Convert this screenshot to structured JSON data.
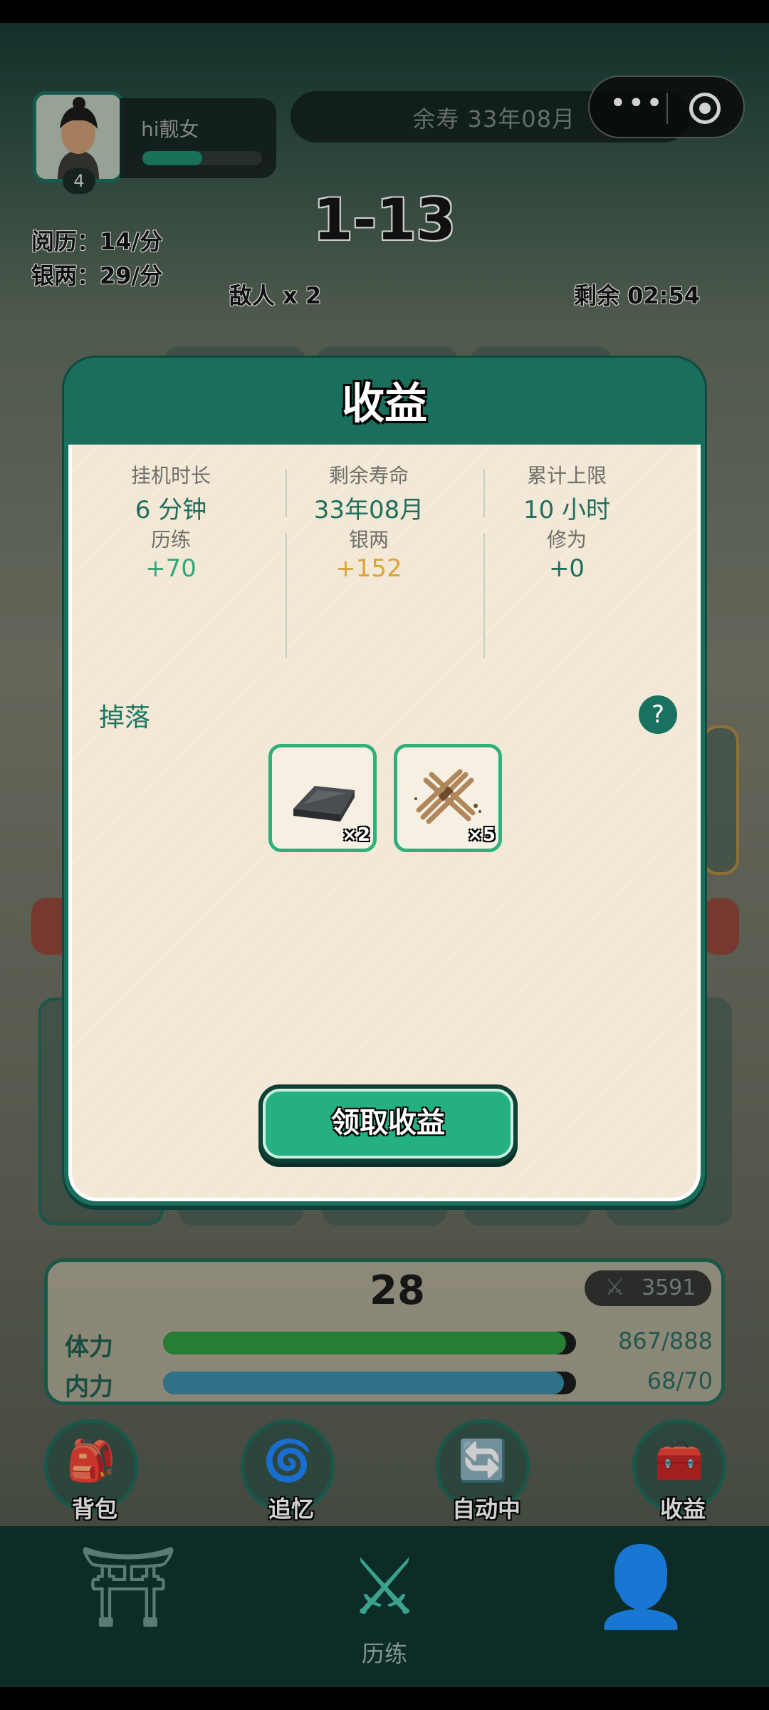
{
  "header": {
    "player_name": "hi靓女",
    "level": "4",
    "exp_fraction": 0.5,
    "lifespan_label": "余寿 33年08月",
    "stage": "1-13",
    "experience_rate": "阅历：14/分",
    "silver_rate": "银两：29/分",
    "enemies": "敌人 x 2",
    "time_left": "剩余 02:54"
  },
  "modal": {
    "title": "收益",
    "stats": [
      {
        "label": "挂机时长",
        "value": "6 分钟",
        "color": "#1f6e5e"
      },
      {
        "label": "剩余寿命",
        "value": "33年08月",
        "color": "#1f6e5e"
      },
      {
        "label": "累计上限",
        "value": "10 小时",
        "color": "#1f6e5e"
      },
      {
        "label": "历练",
        "value": "+70",
        "color": "#2fa879"
      },
      {
        "label": "银两",
        "value": "+152",
        "color": "#d8a53a"
      },
      {
        "label": "修为",
        "value": "+0",
        "color": "#1f6e5e"
      }
    ],
    "drops_title": "掉落",
    "help_label": "?",
    "items": [
      {
        "icon": "iron-ingot-icon",
        "count": "×2"
      },
      {
        "icon": "wood-bundle-icon",
        "count": "×5"
      }
    ],
    "claim_button": "领取收益"
  },
  "status": {
    "level": "28",
    "combat_power": "3591",
    "stamina_label": "体力",
    "stamina_value": "867/888",
    "stamina_fraction": 0.976,
    "stamina_color": "#2e9a3f",
    "inner_label": "内力",
    "inner_value": "68/70",
    "inner_fraction": 0.971,
    "inner_color": "#3b8aa5"
  },
  "actions": [
    {
      "label": "背包",
      "icon": "backpack-icon"
    },
    {
      "label": "追忆",
      "icon": "recall-icon"
    },
    {
      "label": "自动中",
      "icon": "auto-icon"
    },
    {
      "label": "收益",
      "icon": "treasure-chest-icon"
    }
  ],
  "nav": {
    "center_label": "历练"
  }
}
